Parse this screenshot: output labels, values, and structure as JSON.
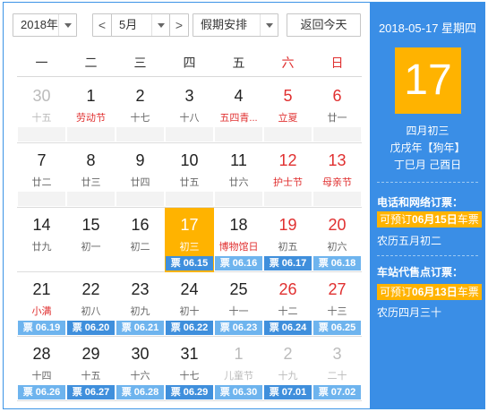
{
  "toolbar": {
    "year": "2018年",
    "prev": "<",
    "month": "5月",
    "next": ">",
    "holiday": "假期安排",
    "today": "返回今天"
  },
  "weekdays": [
    "一",
    "二",
    "三",
    "四",
    "五",
    "六",
    "日"
  ],
  "weeks": [
    [
      {
        "day": "30",
        "lunar": "十五",
        "other": true
      },
      {
        "day": "1",
        "lunar": "劳动节",
        "lunarRed": true
      },
      {
        "day": "2",
        "lunar": "十七"
      },
      {
        "day": "3",
        "lunar": "十八"
      },
      {
        "day": "4",
        "lunar": "五四青...",
        "lunarRed": true
      },
      {
        "day": "5",
        "lunar": "立夏",
        "red": true,
        "lunarRed": true
      },
      {
        "day": "6",
        "lunar": "廿一",
        "red": true
      }
    ],
    [
      {
        "day": "7",
        "lunar": "廿二"
      },
      {
        "day": "8",
        "lunar": "廿三"
      },
      {
        "day": "9",
        "lunar": "廿四"
      },
      {
        "day": "10",
        "lunar": "廿五"
      },
      {
        "day": "11",
        "lunar": "廿六"
      },
      {
        "day": "12",
        "lunar": "护士节",
        "red": true,
        "lunarRed": true
      },
      {
        "day": "13",
        "lunar": "母亲节",
        "red": true,
        "lunarRed": true
      }
    ],
    [
      {
        "day": "14",
        "lunar": "廿九"
      },
      {
        "day": "15",
        "lunar": "初一"
      },
      {
        "day": "16",
        "lunar": "初二"
      },
      {
        "day": "17",
        "lunar": "初三",
        "today": true,
        "ticket": "票 06.15"
      },
      {
        "day": "18",
        "lunar": "博物馆日",
        "lunarRed": true,
        "ticket": "票 06.16"
      },
      {
        "day": "19",
        "lunar": "初五",
        "red": true,
        "ticket": "票 06.17"
      },
      {
        "day": "20",
        "lunar": "初六",
        "red": true,
        "ticket": "票 06.18"
      }
    ],
    [
      {
        "day": "21",
        "lunar": "小满",
        "lunarRed": true,
        "ticket": "票 06.19"
      },
      {
        "day": "22",
        "lunar": "初八",
        "ticket": "票 06.20"
      },
      {
        "day": "23",
        "lunar": "初九",
        "ticket": "票 06.21"
      },
      {
        "day": "24",
        "lunar": "初十",
        "ticket": "票 06.22"
      },
      {
        "day": "25",
        "lunar": "十一",
        "ticket": "票 06.23"
      },
      {
        "day": "26",
        "lunar": "十二",
        "red": true,
        "ticket": "票 06.24"
      },
      {
        "day": "27",
        "lunar": "十三",
        "red": true,
        "ticket": "票 06.25"
      }
    ],
    [
      {
        "day": "28",
        "lunar": "十四",
        "ticket": "票 06.26"
      },
      {
        "day": "29",
        "lunar": "十五",
        "ticket": "票 06.27"
      },
      {
        "day": "30",
        "lunar": "十六",
        "ticket": "票 06.28"
      },
      {
        "day": "31",
        "lunar": "十七",
        "ticket": "票 06.29"
      },
      {
        "day": "1",
        "lunar": "儿童节",
        "other": true,
        "ticket": "票 06.30"
      },
      {
        "day": "2",
        "lunar": "十九",
        "other": true,
        "ticket": "票 07.01"
      },
      {
        "day": "3",
        "lunar": "二十",
        "other": true,
        "ticket": "票 07.02"
      }
    ]
  ],
  "side": {
    "date": "2018-05-17 星期四",
    "big_day": "17",
    "lunar_date": "四月初三",
    "year_ganzhi": "戊戌年【狗年】",
    "month_day_ganzhi": "丁巳月 己酉日",
    "phone_title": "电话和网络订票：",
    "phone_pre": "可预订",
    "phone_date": "06月15日",
    "phone_post": "车票",
    "phone_lunar": "农历五月初二",
    "station_title": "车站代售点订票：",
    "station_pre": "可预订",
    "station_date": "06月13日",
    "station_post": "车票",
    "station_lunar": "农历四月三十"
  },
  "colors": {
    "accent": "#3a8ee6",
    "today": "#ffb300",
    "holiday_red": "#e03030",
    "ticket": "#6eb4ee"
  }
}
